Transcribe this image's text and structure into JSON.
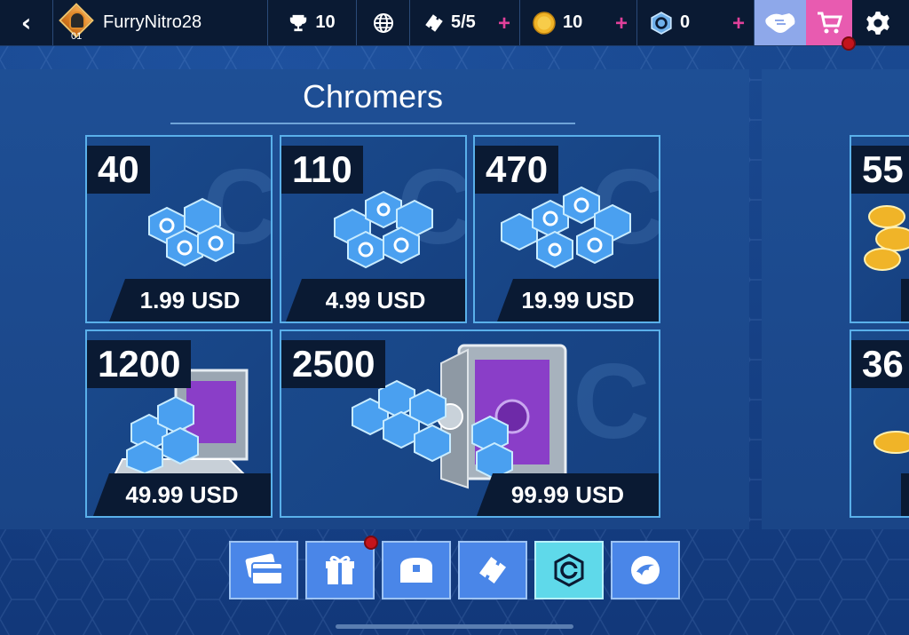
{
  "topbar": {
    "back_label": "‹",
    "username": "FurryNitro28",
    "level": "01",
    "trophies": "10",
    "tickets": "5/5",
    "coins": "10",
    "chromers": "0",
    "plus_label": "+"
  },
  "shop": {
    "title": "Chromers",
    "packs": [
      {
        "amount": "40",
        "price": "1.99 USD"
      },
      {
        "amount": "110",
        "price": "4.99 USD"
      },
      {
        "amount": "470",
        "price": "19.99 USD"
      },
      {
        "amount": "1200",
        "price": "49.99 USD"
      },
      {
        "amount": "2500",
        "price": "99.99 USD"
      }
    ],
    "side_packs": [
      {
        "amount": "55"
      },
      {
        "amount": "36"
      }
    ]
  },
  "bottom_nav": {
    "tabs": [
      "cards-icon",
      "gift-icon",
      "chest-icon",
      "ticket-icon",
      "chromer-icon",
      "boost-icon"
    ],
    "active": "chromer-icon"
  },
  "colors": {
    "accent_pink": "#e85bb0",
    "friends_blue": "#8ea8ea",
    "active_tab": "#5fd9ea",
    "notification_red": "#c4141c"
  }
}
